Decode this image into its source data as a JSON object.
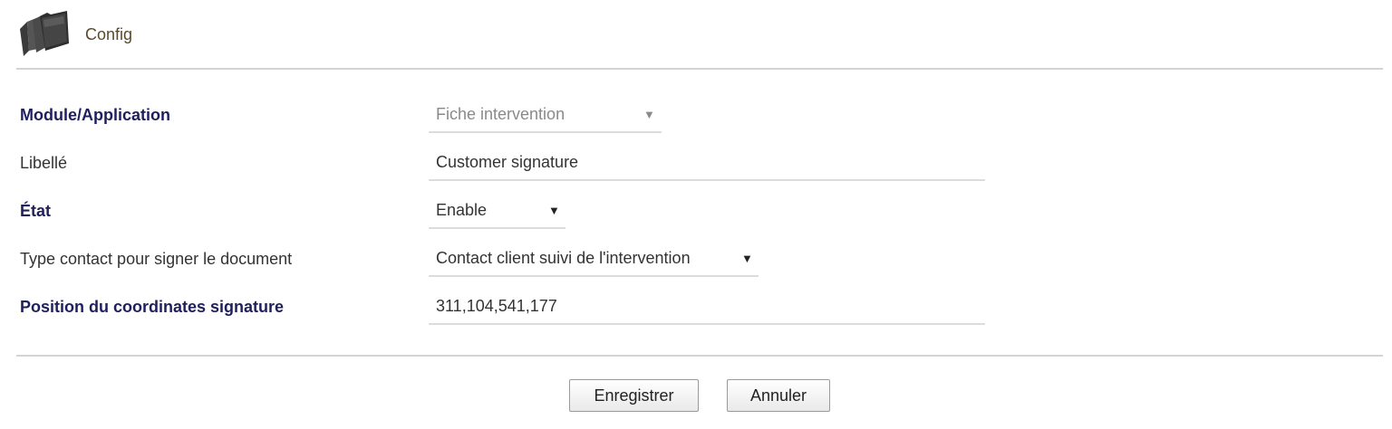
{
  "header": {
    "title": "Config",
    "icon": "folder-stack-icon"
  },
  "form": {
    "module": {
      "label": "Module/Application",
      "value": "Fiche intervention",
      "disabled": true
    },
    "libelle": {
      "label": "Libellé",
      "value": "Customer signature"
    },
    "etat": {
      "label": "État",
      "value": "Enable"
    },
    "type_contact": {
      "label": "Type contact pour signer le document",
      "value": "Contact client suivi de l'intervention"
    },
    "position": {
      "label": "Position du coordinates signature",
      "value": "311,104,541,177"
    }
  },
  "buttons": {
    "save_label": "Enregistrer",
    "cancel_label": "Annuler"
  },
  "colors": {
    "label_bold": "#1f1f5e",
    "title": "#5a4a2a",
    "divider": "#d3d3d3"
  }
}
